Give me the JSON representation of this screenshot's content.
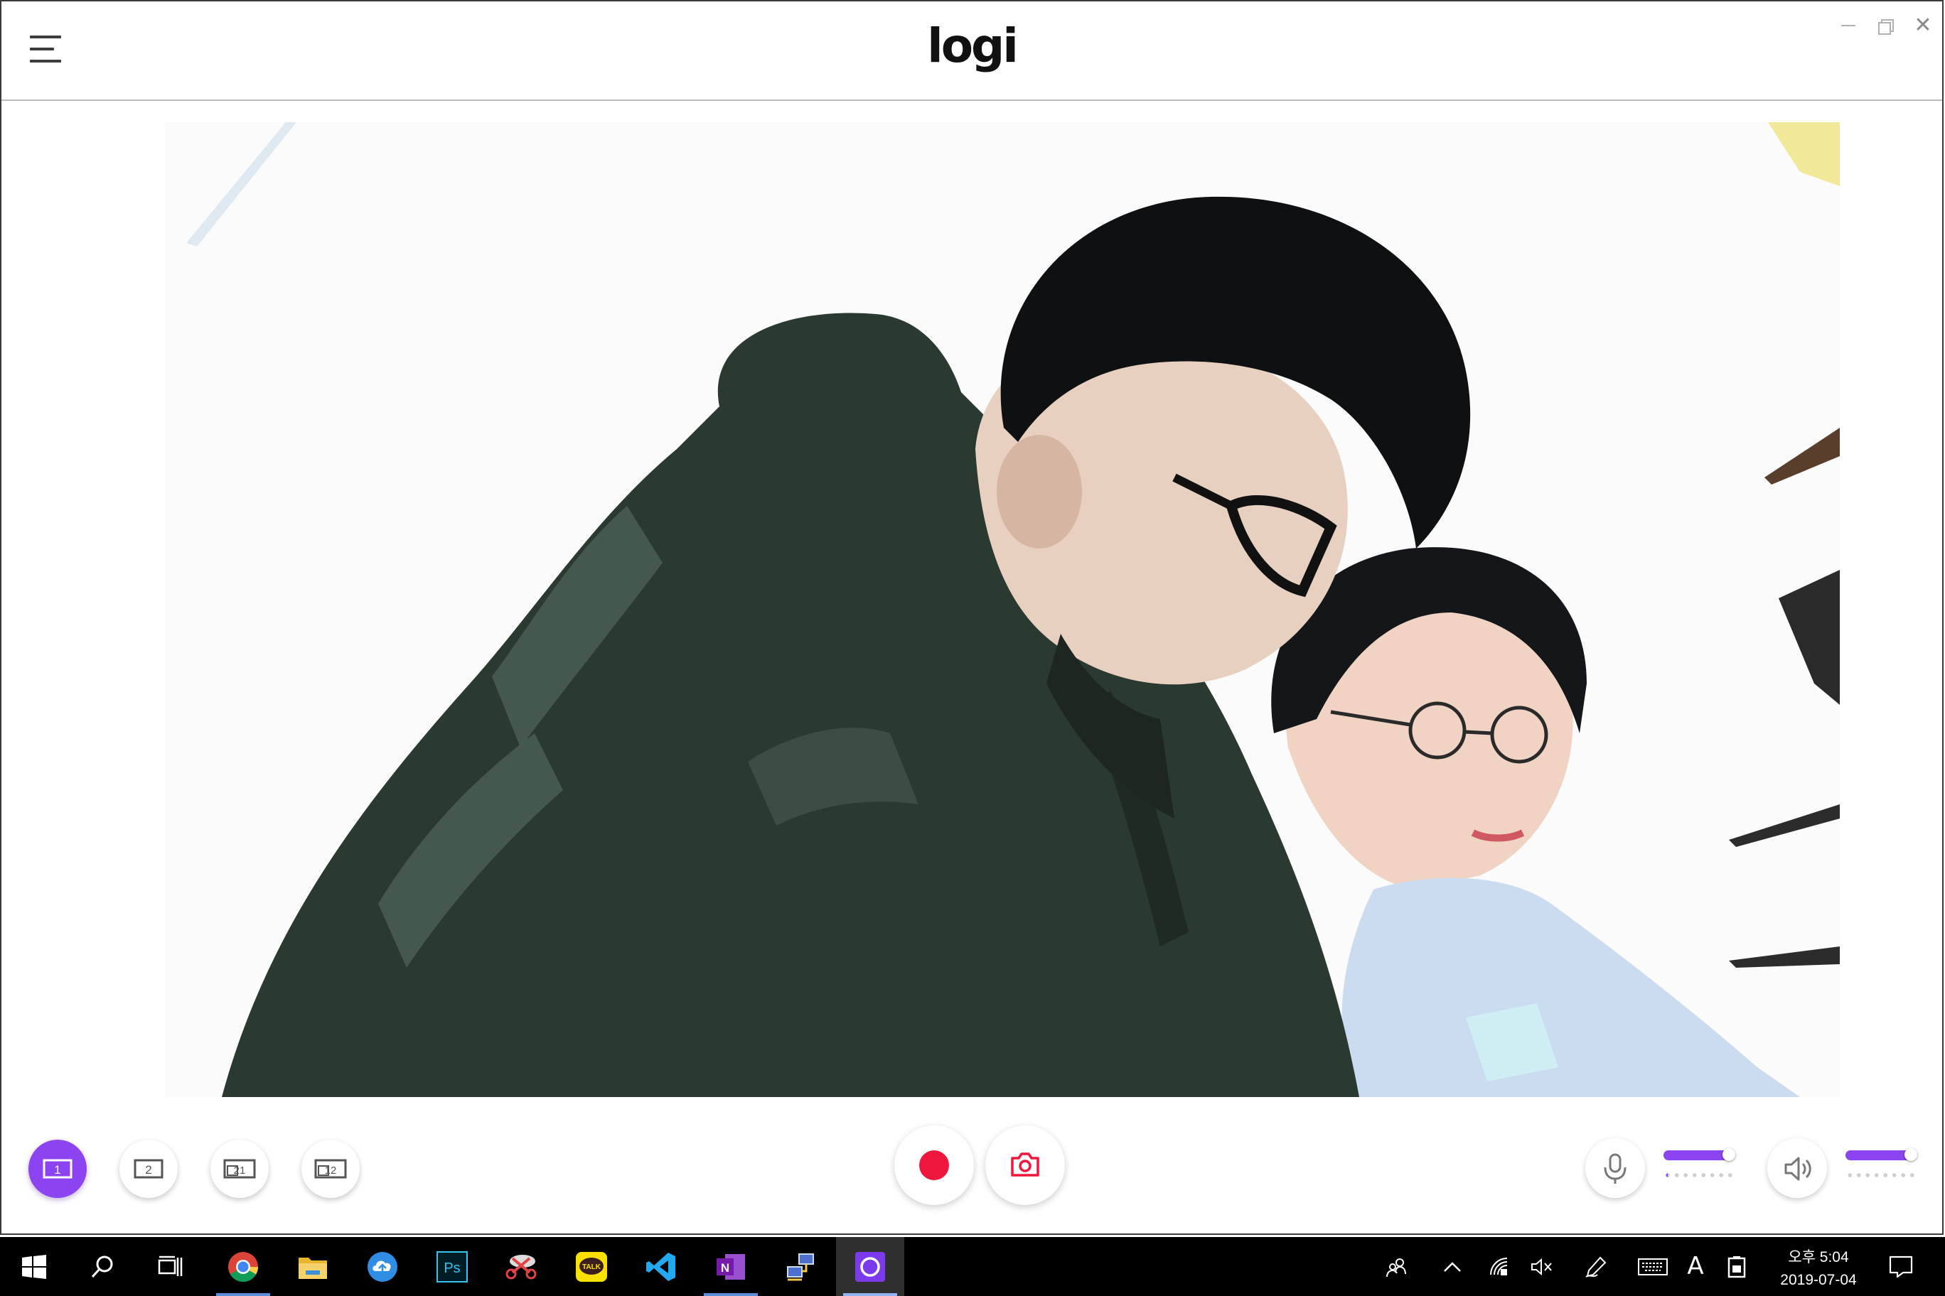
{
  "app": {
    "logo_text": "logi",
    "accent_color": "#8b44f0",
    "record_color": "#f0173d"
  },
  "titlebar": {
    "menu_icon": "hamburger-menu-icon",
    "window_controls": [
      "minimize-icon",
      "restore-icon",
      "close-icon"
    ],
    "close_glyph": "✕"
  },
  "controls": {
    "layouts": [
      {
        "label": "1",
        "icon": "single-view-1-icon",
        "active": true
      },
      {
        "label": "2",
        "icon": "single-view-2-icon",
        "active": false
      },
      {
        "label": "21",
        "icon": "pip-view-2-1-icon",
        "active": false
      },
      {
        "label": "12",
        "icon": "pip-view-1-2-icon",
        "active": false
      }
    ],
    "record_icon": "record-icon",
    "snapshot_icon": "camera-icon",
    "microphone": {
      "icon": "microphone-icon",
      "level": 0.92
    },
    "speaker": {
      "icon": "speaker-icon",
      "level": 0.92
    }
  },
  "taskbar": {
    "apps": [
      "windows-start-icon",
      "search-icon",
      "task-view-icon",
      "chrome-icon",
      "file-explorer-icon",
      "cloud-upload-icon",
      "photoshop-icon",
      "snipping-tool-icon",
      "kakaotalk-icon",
      "vscode-icon",
      "onenote-icon",
      "network-app-icon",
      "logi-capture-icon"
    ],
    "photoshop_label": "Ps",
    "kakaotalk_label": "TALK",
    "onenote_label": "N",
    "tray_icons": [
      "people-icon",
      "chevron-up-icon",
      "wifi-icon",
      "volume-muted-icon",
      "pen-icon",
      "keyboard-icon"
    ],
    "ime_label": "A",
    "clock_time": "오후 5:04",
    "clock_date": "2019-07-04",
    "notification_icon": "action-center-icon"
  }
}
